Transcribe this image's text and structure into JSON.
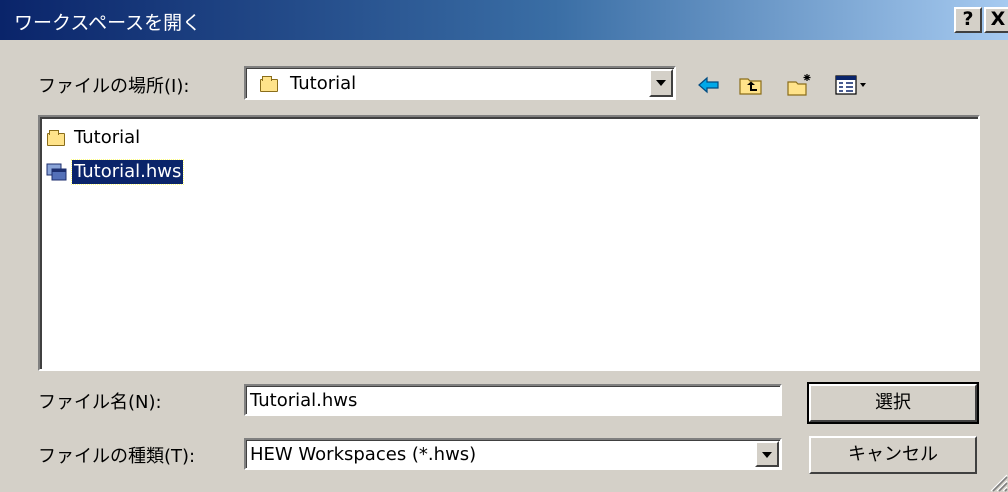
{
  "window": {
    "title": "ワークスペースを開く",
    "help_label": "?",
    "close_label": "X"
  },
  "location": {
    "label": "ファイルの場所(I):",
    "value": "Tutorial"
  },
  "toolbar": {
    "icons": [
      "back-arrow-icon",
      "up-one-level-icon",
      "new-folder-icon",
      "view-menu-icon"
    ]
  },
  "file_list": {
    "items": [
      {
        "label": "Tutorial",
        "icon": "folder-icon",
        "selected": false
      },
      {
        "label": "Tutorial.hws",
        "icon": "workspace-file-icon",
        "selected": true
      }
    ]
  },
  "filename": {
    "label": "ファイル名(N):",
    "value": "Tutorial.hws"
  },
  "filetype": {
    "label": "ファイルの種類(T):",
    "value": "HEW Workspaces (*.hws)"
  },
  "buttons": {
    "select": "選択",
    "cancel": "キャンセル"
  }
}
